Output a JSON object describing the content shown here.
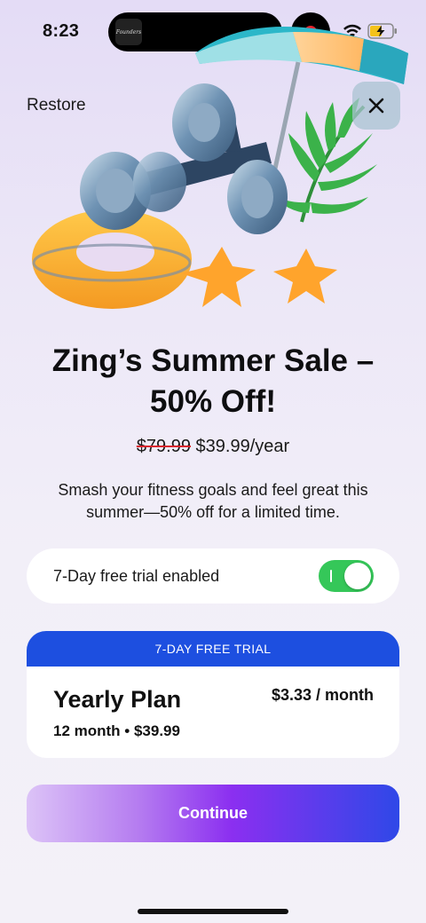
{
  "status_bar": {
    "time": "8:23",
    "island_label": "Founders",
    "record_color": "#e8232c",
    "battery_color": "#f4c21a"
  },
  "header": {
    "restore_label": "Restore",
    "close_icon": "close-icon"
  },
  "hero": {
    "icons": [
      "dumbbell",
      "swim-ring",
      "starfish",
      "beach-umbrella",
      "palm-leaf"
    ]
  },
  "offer": {
    "title": "Zing’s Summer Sale – 50% Off!",
    "old_price": "$79.99",
    "new_price": "$39.99/year",
    "subtitle": "Smash your fitness goals and feel great this summer—50% off for a limited time."
  },
  "trial_toggle": {
    "label": "7-Day free trial enabled",
    "enabled": true,
    "on_color": "#35c759"
  },
  "plan": {
    "banner": "7-DAY FREE TRIAL",
    "name": "Yearly Plan",
    "detail": "12 month • $39.99",
    "monthly": "$3.33 / month",
    "banner_color": "#1d4fe0"
  },
  "cta": {
    "continue_label": "Continue"
  }
}
